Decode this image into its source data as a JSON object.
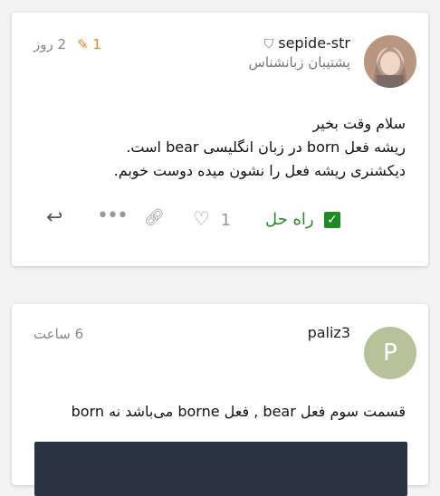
{
  "post1": {
    "username": "sepide-str",
    "title": "پشتیبان زبانشناس",
    "edit_count": "1",
    "time": "2 روز",
    "body_lines": [
      "سلام وقت بخیر",
      "ریشه فعل born در زبان انگلیسی bear است.",
      "دیکشنری ریشه فعل را نشون میده دوست خوبم."
    ],
    "solution_label": "راه حل",
    "like_count": "1"
  },
  "post2": {
    "username": "paliz3",
    "avatar_letter": "P",
    "time": "6 ساعت",
    "body": "قسمت سوم فعل bear , فعل borne می‌باشد نه born"
  },
  "colors": {
    "accent_orange": "#e8862b",
    "solved_green": "#2a8a2a",
    "avatar_green": "#b7c29a"
  }
}
